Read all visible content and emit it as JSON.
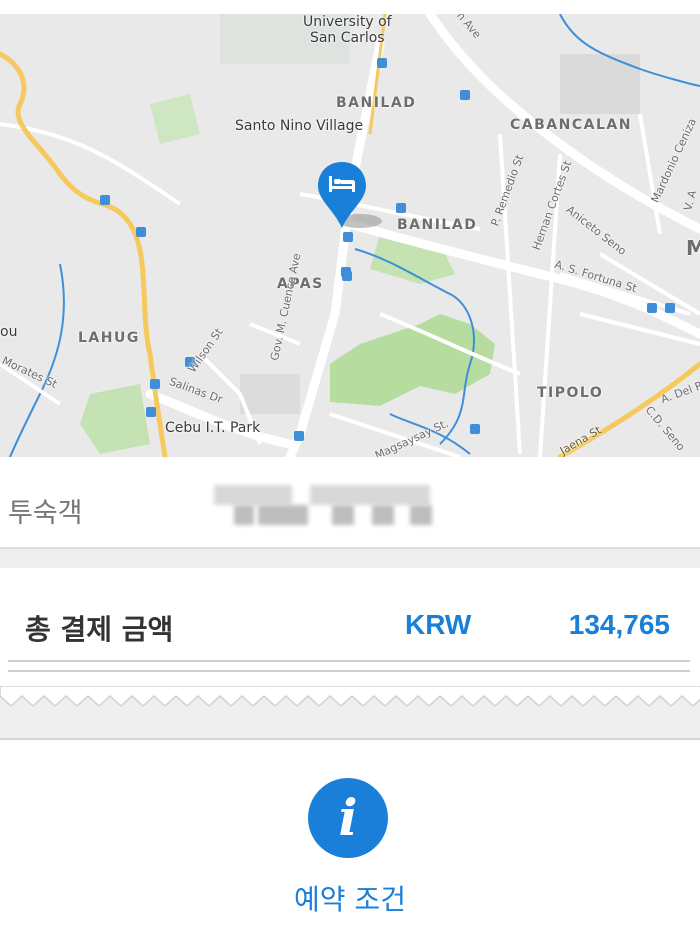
{
  "map": {
    "labels": {
      "university": "University of\nSan Carlos",
      "banilad_top": "BANILAD",
      "santo_nino": "Santo Nino Village",
      "cabancalan": "CABANCALAN",
      "banilad_mid": "BANILAD",
      "apas": "APAS",
      "lahug": "LAHUG",
      "tipolo": "TIPOLO",
      "it_park": "Cebu I.T. Park",
      "cuenco": "Gov. M. Cuenco Ave",
      "salinas": "Salinas Dr",
      "wilson": "Wilson St",
      "fortuna": "A. S. Fortuna St",
      "remedio": "P. Remedio St",
      "hernan": "Hernan Cortes St",
      "aniceto": "Aniceto Seno",
      "mardonio": "Mardonio Ceniza",
      "magsaysay": "Magsaysay St.",
      "jaena": "Jaena St",
      "cd_seno": "C.D. Seno",
      "a_del": "A. Del R",
      "morates": "Morates St",
      "ave_top": "on Ave",
      "ou_partial": "ou",
      "v_a": "V. A",
      "m_partial": "M"
    },
    "pin_icon": "bed-icon"
  },
  "guest": {
    "label": "투숙객"
  },
  "total": {
    "label": "총 결제 금액",
    "currency": "KRW",
    "amount": "134,765"
  },
  "terms": {
    "icon": "info-icon",
    "label": "예약 조건"
  },
  "colors": {
    "accent": "#1a7fd8",
    "road_major": "#f6c95f",
    "park": "#b6dca0",
    "water": "#3e8fd8"
  }
}
